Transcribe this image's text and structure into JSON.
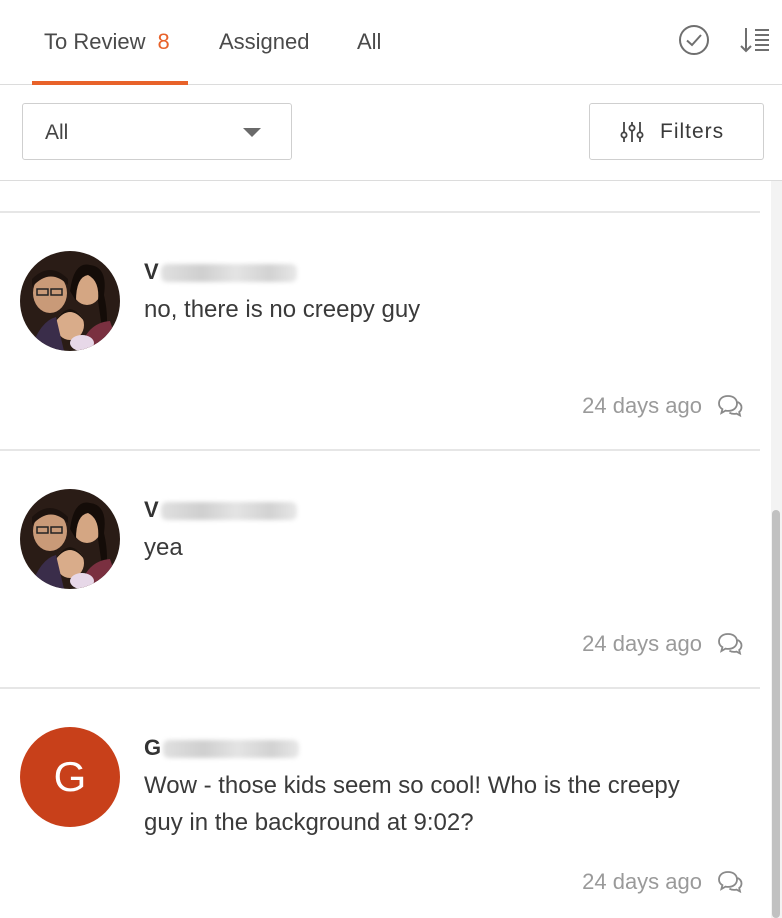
{
  "tabs": [
    {
      "label": "To Review",
      "count": "8",
      "active": true
    },
    {
      "label": "Assigned"
    },
    {
      "label": "All"
    }
  ],
  "header_icons": [
    "check-circle-icon",
    "sort-icon"
  ],
  "filter": {
    "selected": "All",
    "button_label": "Filters"
  },
  "comments": [
    {
      "author_initial": "V",
      "text": "no, there is no creepy guy",
      "time": "24 days ago",
      "avatar": "photo"
    },
    {
      "author_initial": "V",
      "text": "yea",
      "time": "24 days ago",
      "avatar": "photo"
    },
    {
      "author_initial": "G",
      "text": "Wow - those kids seem so cool! Who is the creepy guy in the background at 9:02?",
      "time": "24 days ago",
      "avatar": "letter",
      "avatar_letter": "G"
    }
  ],
  "colors": {
    "accent": "#e8622a",
    "avatar_g": "#c8401a"
  }
}
